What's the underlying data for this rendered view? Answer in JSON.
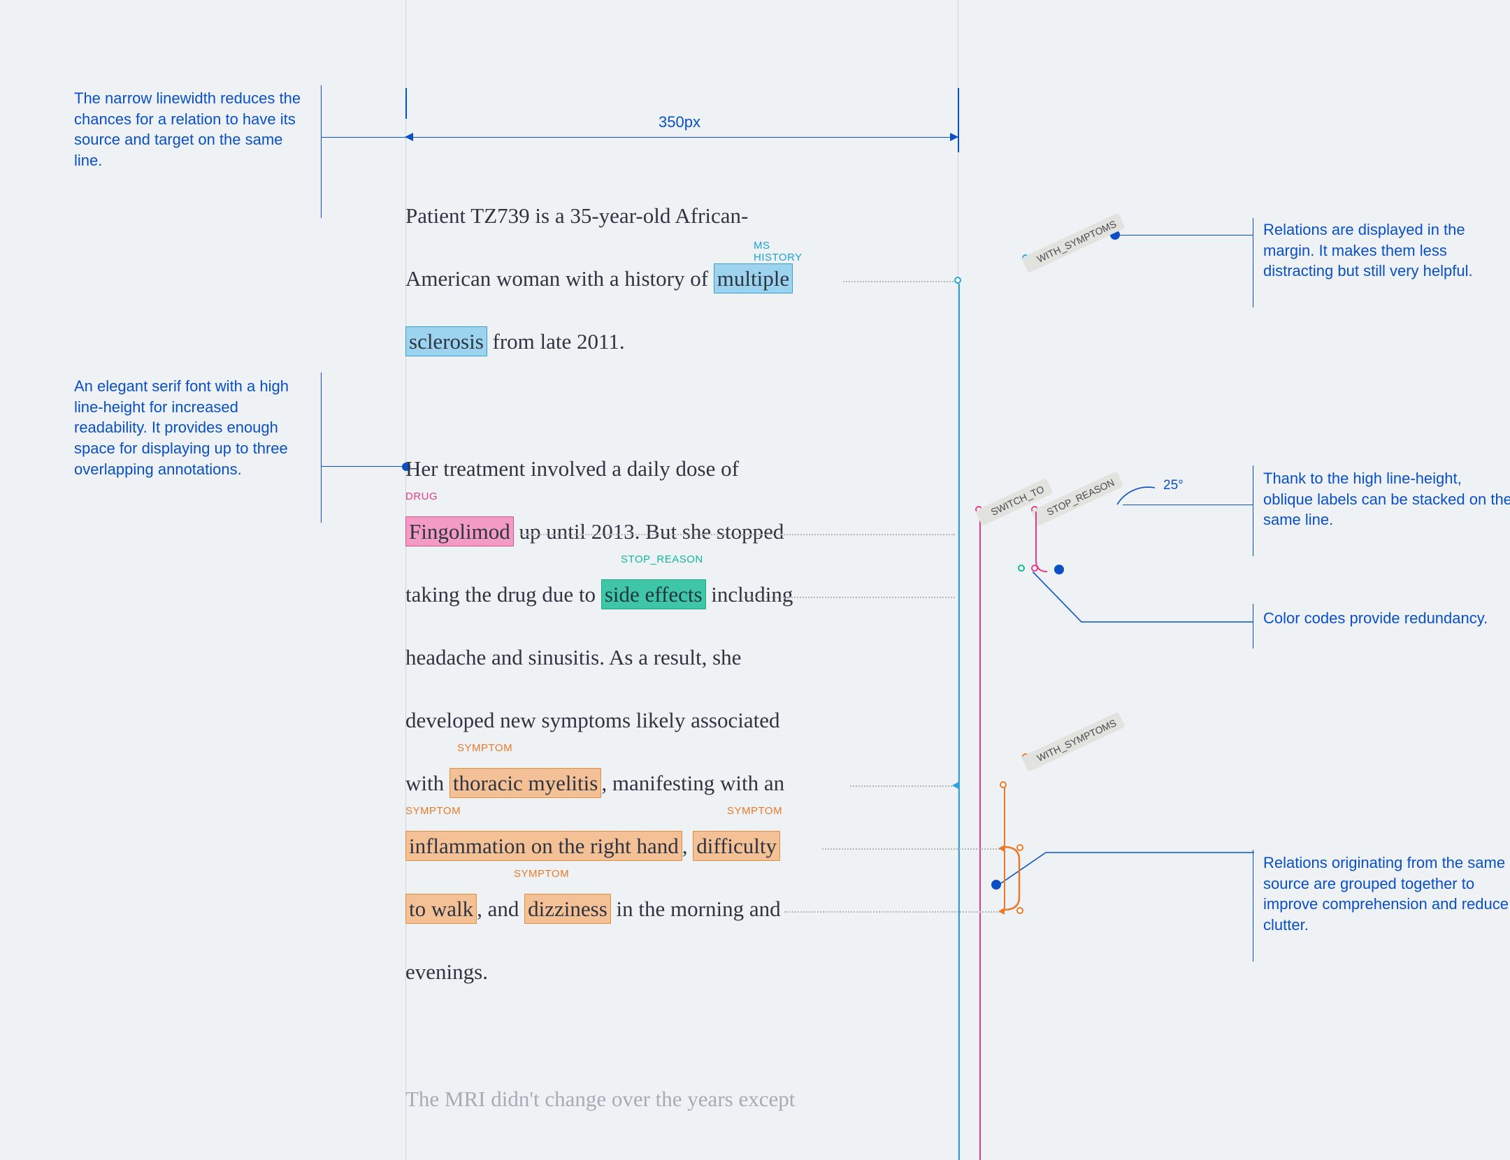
{
  "callouts": {
    "left1": "The narrow linewidth reduces the chances for a relation to have its source and target on the same line.",
    "left2": "An elegant serif font with a high line-height for increased readability. It provides enough space for displaying up to three overlapping annotations.",
    "right1": "Relations are displayed in the margin. It makes them less distracting but still very helpful.",
    "right2": "Thank to the high line-height, oblique labels can be stacked on the same line.",
    "right3": "Color codes provide redundancy.",
    "right4": "Relations originating from the same source are grouped together to improve comprehension and reduce clutter."
  },
  "dimension": {
    "width_label": "350px",
    "angle_label": "25°"
  },
  "tags": {
    "ms_top": "MS",
    "history": "HISTORY",
    "drug": "DRUG",
    "stop_reason": "STOP_REASON",
    "symptom": "SYMPTOM"
  },
  "relations": {
    "with_symptoms": "WITH_SYMPTOMS",
    "switch_to": "SWITCH_TO",
    "stop_reason": "STOP_REASON"
  },
  "text": {
    "p1_a": "Patient TZ739 is a 35-year-old African-",
    "p1_b": "American woman with a history of ",
    "p1_hl1": "multiple",
    "p1_c": "",
    "p1_hl2": "sclerosis",
    "p1_d": " from late 2011.",
    "p2_a": "Her treatment involved a daily dose of",
    "p2_hl_drug": "Fingolimod",
    "p2_b": " up until 2013. But she stopped",
    "p2_c": "taking the drug due to ",
    "p2_hl_se": "side effects",
    "p2_d": " including",
    "p2_e": "headache and sinusitis. As a result, she",
    "p2_f": "developed new symptoms likely associated",
    "p2_g": "with ",
    "p2_hl_tm": "thoracic myelitis",
    "p2_h": ", manifesting with an",
    "p2_hl_inf": "inflammation on the right hand",
    "p2_i": ", ",
    "p2_hl_dif": "difficulty",
    "p2_hl_tw": "to walk",
    "p2_j": ", and ",
    "p2_hl_diz": "dizziness",
    "p2_k": " in the morning and",
    "p2_l": "evenings.",
    "p3_a": "The MRI didn't change over the years except"
  }
}
